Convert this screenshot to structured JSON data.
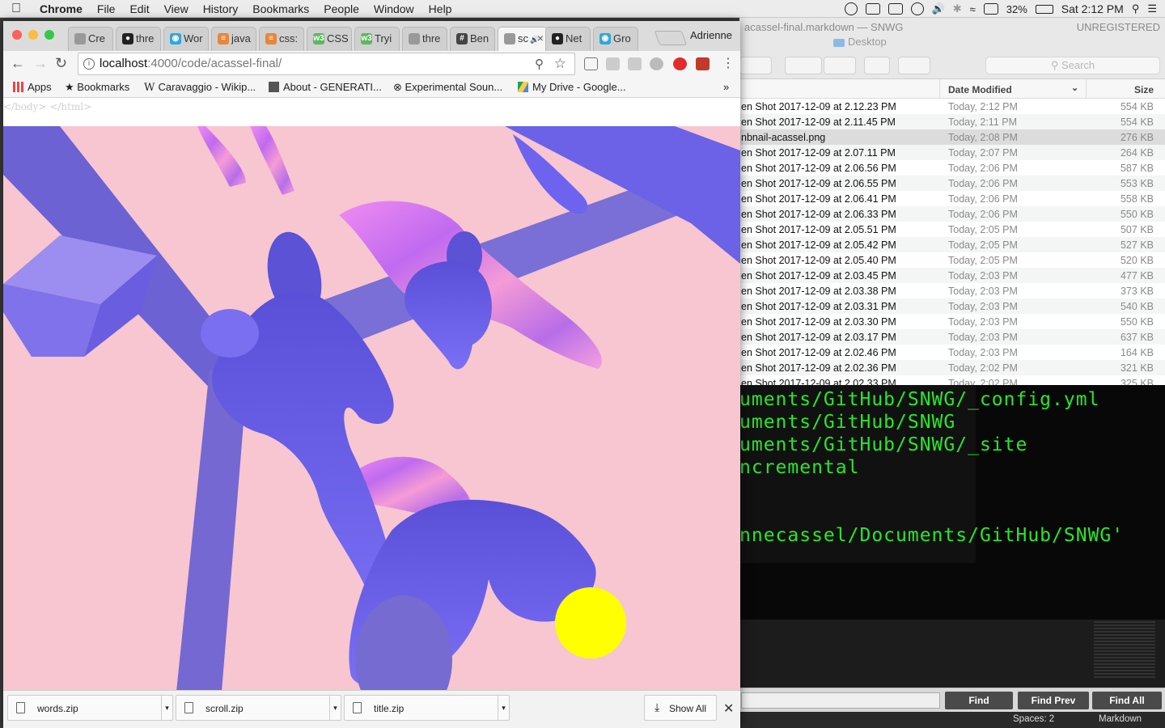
{
  "menubar": {
    "app": "Chrome",
    "items": [
      "File",
      "Edit",
      "View",
      "History",
      "Bookmarks",
      "People",
      "Window",
      "Help"
    ],
    "battery": "32%",
    "clock": "Sat 2:12 PM"
  },
  "chrome": {
    "tabs": [
      {
        "label": "Cre",
        "icon": "document-icon"
      },
      {
        "label": "thre",
        "icon": "github-icon"
      },
      {
        "label": "Wor",
        "icon": "globe-icon"
      },
      {
        "label": "java",
        "icon": "stack-icon"
      },
      {
        "label": "css:",
        "icon": "stack-icon"
      },
      {
        "label": "CSS",
        "icon": "w3-icon"
      },
      {
        "label": "Tryi",
        "icon": "w3-icon"
      },
      {
        "label": "thre",
        "icon": "document-icon"
      },
      {
        "label": "Ben",
        "icon": "hash-icon"
      },
      {
        "label": "sc",
        "icon": "audio-icon",
        "active": true
      },
      {
        "label": "Net",
        "icon": "github-icon"
      },
      {
        "label": "Gro",
        "icon": "globe-icon"
      }
    ],
    "profile": "Adrienne",
    "url_host": "localhost",
    "url_path": ":4000/code/acassel-final/",
    "bookmarks": [
      "Apps",
      "Bookmarks",
      "Caravaggio - Wikip...",
      "About - GENERATI...",
      "Experimental Soun...",
      "My Drive - Google..."
    ],
    "page_tail": "</body> </html>",
    "downloads": [
      "words.zip",
      "scroll.zip",
      "title.zip"
    ],
    "show_all": "Show All"
  },
  "sublime": {
    "title": "acassel-final.markdown — SNWG",
    "unregistered": "UNREGISTERED",
    "finder_folder": "Desktop",
    "search_placeholder": "Search",
    "col_date": "Date Modified",
    "col_size": "Size",
    "find": "Find",
    "find_prev": "Find Prev",
    "find_all": "Find All",
    "spaces": "Spaces: 2",
    "syntax": "Markdown"
  },
  "files": [
    {
      "name": "en Shot 2017-12-09 at 2.12.23 PM",
      "date": "Today, 2:12 PM",
      "size": "554 KB"
    },
    {
      "name": "en Shot 2017-12-09 at 2.11.45 PM",
      "date": "Today, 2:11 PM",
      "size": "554 KB"
    },
    {
      "name": "nbnail-acassel.png",
      "date": "Today, 2:08 PM",
      "size": "276 KB"
    },
    {
      "name": "en Shot 2017-12-09 at 2.07.11 PM",
      "date": "Today, 2:07 PM",
      "size": "264 KB"
    },
    {
      "name": "en Shot 2017-12-09 at 2.06.56 PM",
      "date": "Today, 2:06 PM",
      "size": "587 KB"
    },
    {
      "name": "en Shot 2017-12-09 at 2.06.55 PM",
      "date": "Today, 2:06 PM",
      "size": "553 KB"
    },
    {
      "name": "en Shot 2017-12-09 at 2.06.41 PM",
      "date": "Today, 2:06 PM",
      "size": "558 KB"
    },
    {
      "name": "en Shot 2017-12-09 at 2.06.33 PM",
      "date": "Today, 2:06 PM",
      "size": "550 KB"
    },
    {
      "name": "en Shot 2017-12-09 at 2.05.51 PM",
      "date": "Today, 2:05 PM",
      "size": "507 KB"
    },
    {
      "name": "en Shot 2017-12-09 at 2.05.42 PM",
      "date": "Today, 2:05 PM",
      "size": "527 KB"
    },
    {
      "name": "en Shot 2017-12-09 at 2.05.40 PM",
      "date": "Today, 2:05 PM",
      "size": "520 KB"
    },
    {
      "name": "en Shot 2017-12-09 at 2.03.45 PM",
      "date": "Today, 2:03 PM",
      "size": "477 KB"
    },
    {
      "name": "en Shot 2017-12-09 at 2.03.38 PM",
      "date": "Today, 2:03 PM",
      "size": "373 KB"
    },
    {
      "name": "en Shot 2017-12-09 at 2.03.31 PM",
      "date": "Today, 2:03 PM",
      "size": "540 KB"
    },
    {
      "name": "en Shot 2017-12-09 at 2.03.30 PM",
      "date": "Today, 2:03 PM",
      "size": "550 KB"
    },
    {
      "name": "en Shot 2017-12-09 at 2.03.17 PM",
      "date": "Today, 2:03 PM",
      "size": "637 KB"
    },
    {
      "name": "en Shot 2017-12-09 at 2.02.46 PM",
      "date": "Today, 2:03 PM",
      "size": "164 KB"
    },
    {
      "name": "en Shot 2017-12-09 at 2.02.36 PM",
      "date": "Today, 2:02 PM",
      "size": "321 KB"
    },
    {
      "name": "en Shot 2017-12-09 at 2.02.33 PM",
      "date": "Today, 2:02 PM",
      "size": "325 KB"
    }
  ],
  "terminal": {
    "lines": [
      "uments/GitHub/SNWG/_config.yml",
      "uments/GitHub/SNWG",
      "uments/GitHub/SNWG/_site",
      "ncremental",
      "",
      "",
      "nnecassel/Documents/GitHub/SNWG'"
    ]
  },
  "colors": {
    "scene_bg": "#f7c6d0",
    "figure": "#6e63ee",
    "beam": "#7a6fd6",
    "sun": "#ffff00",
    "terminal_text": "#27e827"
  }
}
